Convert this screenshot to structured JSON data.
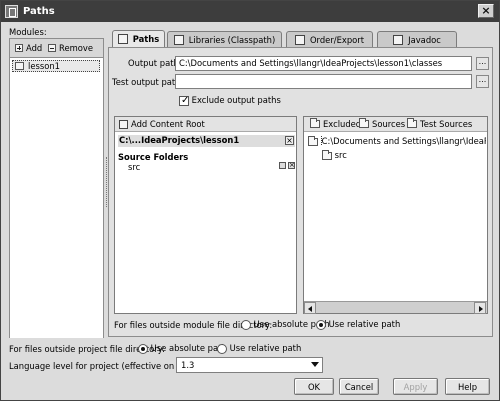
{
  "window": {
    "title": "Paths",
    "close_symbol": "×"
  },
  "modules": {
    "label": "Modules:",
    "add_label": "Add",
    "remove_label": "Remove",
    "items": [
      "lesson1"
    ]
  },
  "tabs": [
    {
      "label": "Paths",
      "icon": "paths-icon"
    },
    {
      "label": "Libraries (Classpath)",
      "icon": "libraries-icon"
    },
    {
      "label": "Order/Export",
      "icon": "order-export-icon"
    },
    {
      "label": "Javadoc",
      "icon": "javadoc-icon"
    }
  ],
  "paths": {
    "output_label": "Output path:",
    "output_value": "C:\\Documents and Settings\\llangr\\IdeaProjects\\lesson1\\classes",
    "test_output_label": "Test output path:",
    "test_output_value": "",
    "exclude_label": "Exclude output paths",
    "exclude_checked": true,
    "browse_label": "..."
  },
  "content_root": {
    "add_label": "Add Content Root",
    "root_label": "C:\\...IdeaProjects\\lesson1",
    "source_folders_label": "Source Folders",
    "source_folder": "src",
    "remove_symbol": "×"
  },
  "tree_toolbar": {
    "excluded_label": "Excluded",
    "sources_label": "Sources",
    "test_sources_label": "Test Sources"
  },
  "tree": {
    "root_path": "C:\\Documents and Settings\\llangr\\IdeaProjects\\les",
    "child": "src"
  },
  "module_outside": {
    "label": "For files outside module file directory:",
    "absolute_label": "Use absolute path",
    "relative_label": "Use relative path",
    "selected": "relative"
  },
  "project_outside": {
    "label": "For files outside project file directory:",
    "absolute_label": "Use absolute path",
    "relative_label": "Use relative path",
    "selected": "absolute"
  },
  "language": {
    "label": "Language level for project (effective on restart):",
    "value": "1.3"
  },
  "buttons": {
    "ok": "OK",
    "cancel": "Cancel",
    "apply": "Apply",
    "help": "Help"
  }
}
